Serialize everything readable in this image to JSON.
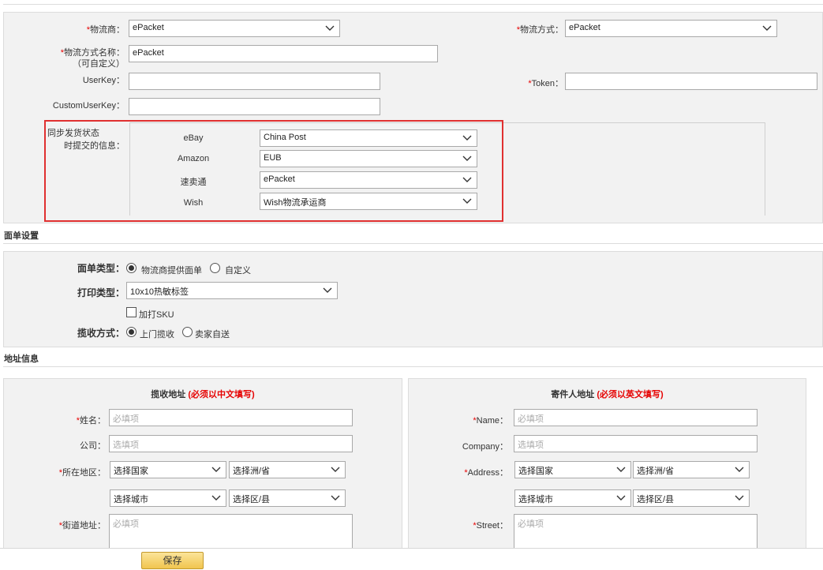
{
  "carrier": {
    "required_mark": "*",
    "provider_label": "物流商：",
    "provider_value": "ePacket",
    "method_label": "物流方式：",
    "method_value": "ePacket",
    "name_label_line1": "物流方式名称：",
    "name_label_line2": "（可自定义）",
    "name_value": "ePacket",
    "userkey_label": "UserKey：",
    "token_label": "Token：",
    "customuserkey_label": "CustomUserKey：",
    "sync_label_line1": "同步发货状态",
    "sync_label_line2": "时提交的信息：",
    "platforms": [
      {
        "name": "eBay",
        "value": "China Post"
      },
      {
        "name": "Amazon",
        "value": "EUB"
      },
      {
        "name": "速卖通",
        "value": "ePacket"
      },
      {
        "name": "Wish",
        "value": "Wish物流承运商"
      }
    ]
  },
  "label_settings": {
    "section_title": "面单设置",
    "type_label": "面单类型：",
    "type_options": [
      "物流商提供面单",
      "自定义"
    ],
    "print_label": "打印类型：",
    "print_value": "10x10热敏标签",
    "sku_checkbox": "加打SKU",
    "pickup_label": "揽收方式：",
    "pickup_options": [
      "上门揽收",
      "卖家自送"
    ]
  },
  "address": {
    "section_title": "地址信息",
    "pickup": {
      "title": "揽收地址",
      "note": "(必须以中文填写)",
      "name_label": "姓名：",
      "name_placeholder": "必填项",
      "company_label": "公司：",
      "company_placeholder": "选填项",
      "region_label": "所在地区：",
      "country": "选择国家",
      "state": "选择洲/省",
      "city": "选择城市",
      "district": "选择区/县",
      "street_label": "街道地址：",
      "street_placeholder": "必填项"
    },
    "sender": {
      "title": "寄件人地址",
      "note": "(必须以英文填写)",
      "name_label": "Name：",
      "name_placeholder": "必填项",
      "company_label": "Company：",
      "company_placeholder": "选填项",
      "region_label": "Address：",
      "country": "选择国家",
      "state": "选择洲/省",
      "city": "选择城市",
      "district": "选择区/县",
      "street_label": "Street：",
      "street_placeholder": "必填项"
    }
  },
  "footer": {
    "save_label": "保存"
  }
}
